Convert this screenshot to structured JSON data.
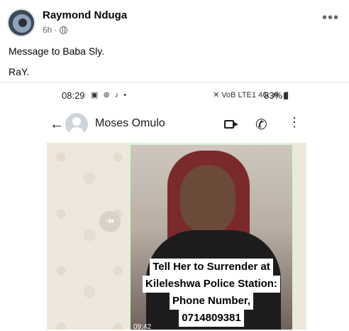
{
  "post": {
    "author": "Raymond Nduga",
    "time": "6h ·",
    "text_line1": "Message to Baba Sly.",
    "text_line2": "RaY.",
    "more_label": "•••"
  },
  "screenshot": {
    "status_time": "08:29",
    "status_left_icons": "▣ ⊛ ♪ •",
    "status_right": "✕ VoB LTE1 4G .ıll .ıll",
    "battery": "83%",
    "contact_name": "Moses Omulo",
    "back_glyph": "←",
    "call_glyph": "✆",
    "menu_glyph": "⋮",
    "forward_glyph": "↠",
    "caption_lines": [
      "Tell Her to Surrender at",
      "Kileleshwa Police Station:",
      "Phone Number,",
      "0714809381"
    ],
    "message_time": "09:42"
  },
  "icons": {
    "privacy": "globe-icon",
    "more": "more-options-icon"
  }
}
